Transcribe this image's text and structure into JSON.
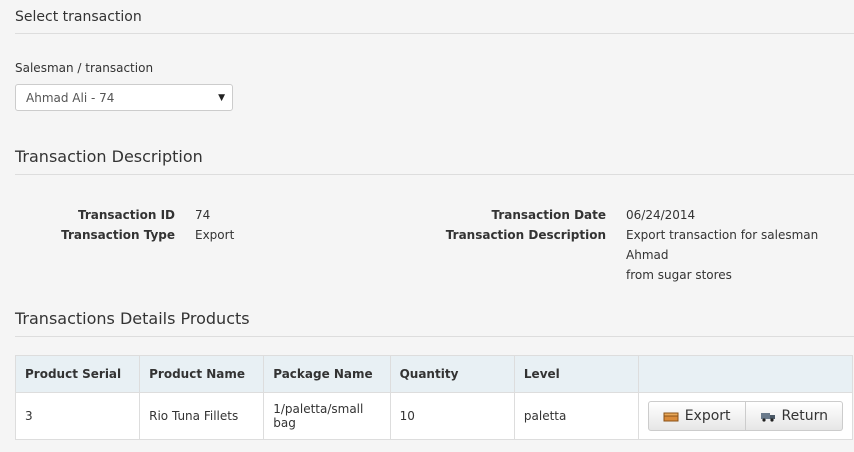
{
  "header": {
    "title": "Select transaction"
  },
  "selector": {
    "label": "Salesman / transaction",
    "selected": "Ahmad Ali - 74"
  },
  "description": {
    "title": "Transaction Description",
    "id_label": "Transaction ID",
    "id_value": "74",
    "type_label": "Transaction Type",
    "type_value": "Export",
    "date_label": "Transaction Date",
    "date_value": "06/24/2014",
    "desc_label": "Transaction Description",
    "desc_value_line1": "Export transaction for salesman Ahmad",
    "desc_value_line2": "from sugar stores"
  },
  "products": {
    "title": "Transactions Details Products",
    "columns": [
      "Product Serial",
      "Product Name",
      "Package Name",
      "Quantity",
      "Level",
      ""
    ],
    "rows": [
      {
        "serial": "3",
        "name": "Rio Tuna Fillets",
        "package": "1/paletta/small bag",
        "quantity": "10",
        "level": "paletta"
      }
    ],
    "export_label": "Export",
    "return_label": "Return"
  },
  "icons": {
    "export": "box-icon",
    "return": "truck-icon"
  },
  "colors": {
    "header_bg": "#e8f0f4",
    "page_bg": "#f5f5f5"
  }
}
